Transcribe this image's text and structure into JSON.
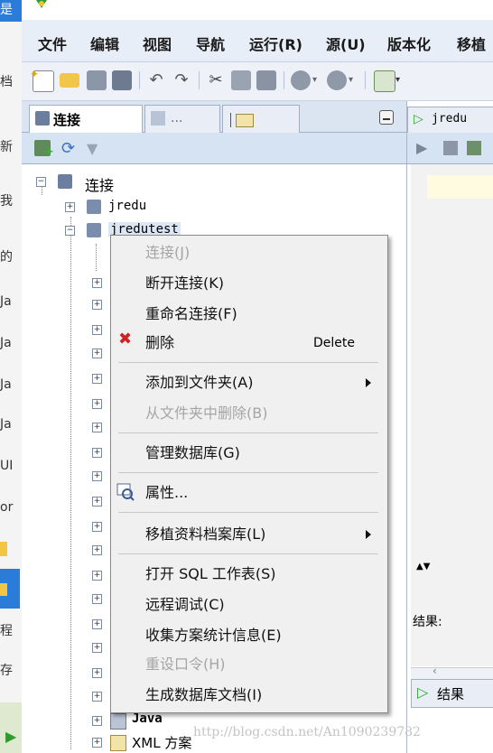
{
  "menubar": [
    "文件",
    "编辑",
    "视图",
    "导航",
    "运行(R)",
    "源(U)",
    "版本化",
    "移植"
  ],
  "left_strip": {
    "top": "是",
    "items": [
      "档",
      "新",
      "我",
      "的",
      "Ja",
      "Ja",
      "Ja",
      "Ja",
      "UI",
      "or",
      "程",
      "存"
    ]
  },
  "panel": {
    "tab_connections": "连接",
    "tab_reports": "...",
    "tree": {
      "root": "连接",
      "nodes": [
        "jredu",
        "jredutest",
        "Java",
        "XML 方案"
      ]
    }
  },
  "editor": {
    "tab": "jredu",
    "result_tab": "结果",
    "result_label": "结果:"
  },
  "context_menu": {
    "connect": "连接(J)",
    "disconnect": "断开连接(K)",
    "rename": "重命名连接(F)",
    "delete": "删除",
    "delete_shortcut": "Delete",
    "add_to_folder": "添加到文件夹(A)",
    "remove_from_folder": "从文件夹中删除(B)",
    "manage_db": "管理数据库(G)",
    "properties": "属性...",
    "migration_repo": "移植资料档案库(L)",
    "open_sql": "打开 SQL 工作表(S)",
    "remote_debug": "远程调试(C)",
    "gather_stats": "收集方案统计信息(E)",
    "reset_password": "重设口令(H)",
    "gen_db_doc": "生成数据库文档(I)"
  },
  "watermark": "http://blog.csdn.net/An1090239782"
}
